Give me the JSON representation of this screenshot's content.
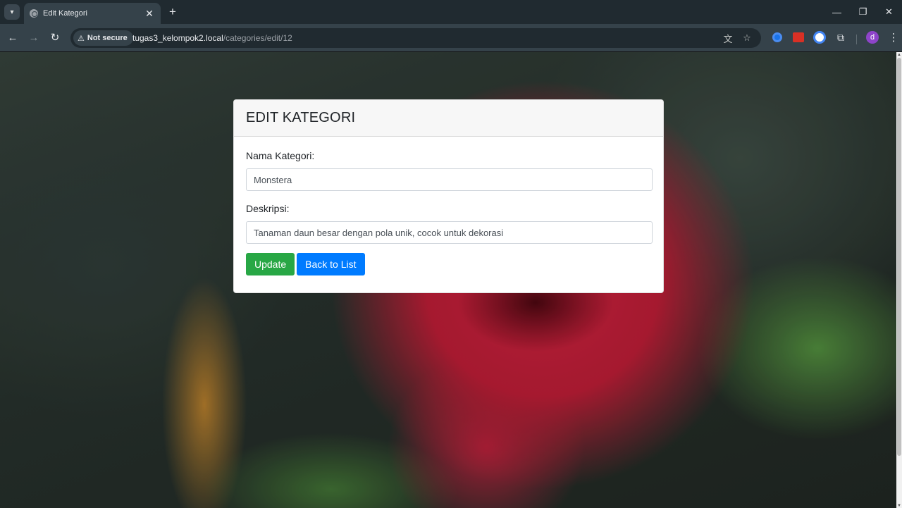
{
  "browser": {
    "tab_title": "Edit Kategori",
    "tab_close": "✕",
    "new_tab": "+",
    "security_label": "Not secure",
    "url_host": "tugas3_kelompok2.local",
    "url_path": "/categories/edit/12",
    "profile_initial": "d",
    "icons": [
      "tab-search-icon",
      "globe-icon",
      "back-arrow-icon",
      "forward-arrow-icon",
      "reload-icon",
      "warning-icon",
      "translate-icon",
      "bookmark-star-icon",
      "extension-icon",
      "kebab-menu-icon",
      "minimize-icon",
      "restore-icon",
      "close-icon"
    ]
  },
  "page": {
    "heading": "EDIT KATEGORI",
    "fields": {
      "name_label": "Nama Kategori:",
      "name_value": "Monstera",
      "description_label": "Deskripsi:",
      "description_value": "Tanaman daun besar dengan pola unik, cocok untuk dekorasi"
    },
    "buttons": {
      "update": "Update",
      "back": "Back to List"
    }
  },
  "colors": {
    "update_button": "#28a745",
    "back_button": "#007bff",
    "card_header_bg": "#f7f7f7",
    "chrome_bg": "#35424a"
  }
}
